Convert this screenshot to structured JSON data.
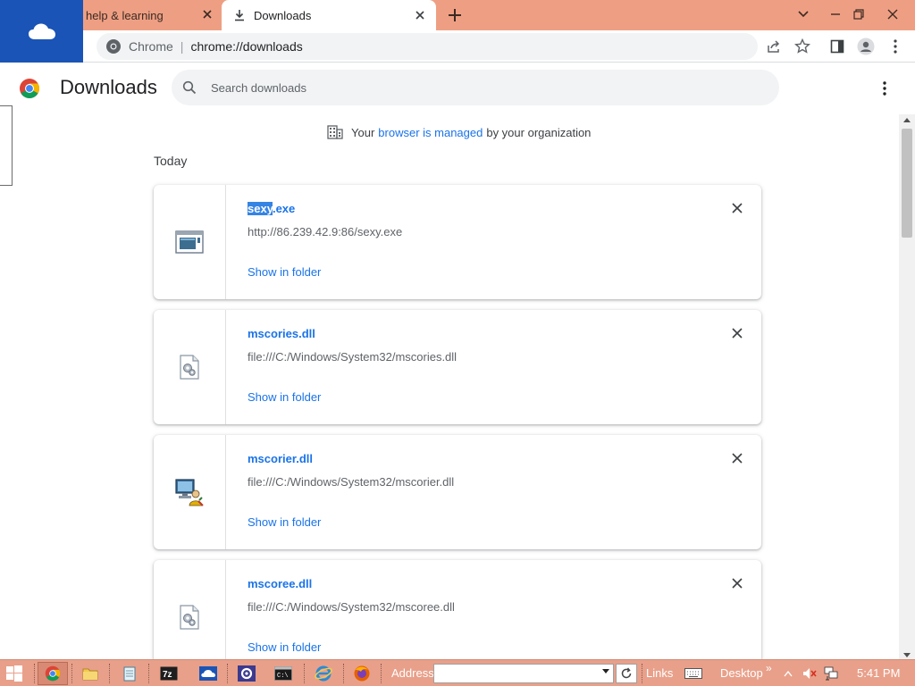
{
  "browser": {
    "tabs": [
      {
        "title": "help & learning",
        "active": false
      },
      {
        "title": "Downloads",
        "active": true
      }
    ],
    "omnibox": {
      "site_name": "Chrome",
      "separator": "|",
      "url": "chrome://downloads"
    }
  },
  "page": {
    "title": "Downloads",
    "search_placeholder": "Search downloads",
    "managed_notice": {
      "prefix": "Your",
      "link": "browser is managed",
      "suffix": "by your organization"
    },
    "date_group": "Today"
  },
  "downloads": [
    {
      "name_highlight": "sexy",
      "name_rest": ".exe",
      "url": "http://86.239.42.9:86/sexy.exe",
      "action": "Show in folder",
      "icon": "exe-window-icon"
    },
    {
      "name": "mscories.dll",
      "url": "file:///C:/Windows/System32/mscories.dll",
      "action": "Show in folder",
      "icon": "dll-gear-icon"
    },
    {
      "name": "mscorier.dll",
      "url": "file:///C:/Windows/System32/mscorier.dll",
      "action": "Show in folder",
      "icon": "computer-user-icon"
    },
    {
      "name": "mscoree.dll",
      "url": "file:///C:/Windows/System32/mscoree.dll",
      "action": "Show in folder",
      "icon": "dll-gear-icon"
    }
  ],
  "taskbar": {
    "address_label": "Address",
    "address_value": "",
    "links_label": "Links",
    "desktop_label": "Desktop",
    "chevron": "»",
    "clock": "5:41 PM"
  },
  "colors": {
    "tabstrip": "#ee9f83",
    "onedrive_tile": "#1a54b6",
    "link_blue": "#1a73e8",
    "taskbar": "#e8a08a"
  }
}
